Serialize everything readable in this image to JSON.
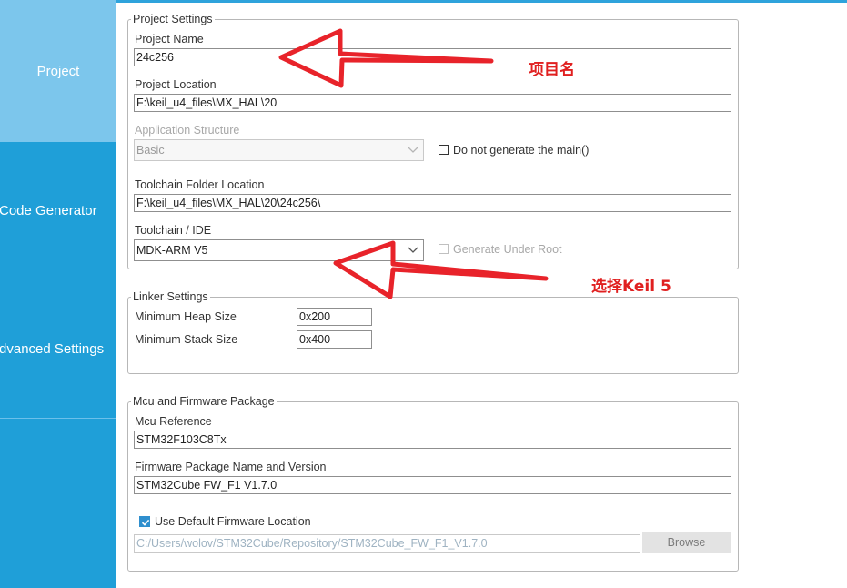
{
  "sidebar": {
    "items": [
      {
        "label": "Project",
        "active": true
      },
      {
        "label": "Code Generator",
        "active": false
      },
      {
        "label": "Advanced Settings",
        "active": false
      }
    ]
  },
  "project_settings": {
    "legend": "Project Settings",
    "project_name_label": "Project Name",
    "project_name_value": "24c256",
    "project_location_label": "Project Location",
    "project_location_value": "F:\\keil_u4_files\\MX_HAL\\20",
    "app_structure_label": "Application Structure",
    "app_structure_value": "Basic",
    "no_main_label": "Do not generate the main()",
    "toolchain_folder_label": "Toolchain Folder Location",
    "toolchain_folder_value": "F:\\keil_u4_files\\MX_HAL\\20\\24c256\\",
    "toolchain_ide_label": "Toolchain / IDE",
    "toolchain_ide_value": "MDK-ARM V5",
    "generate_under_root_label": "Generate Under Root"
  },
  "linker_settings": {
    "legend": "Linker Settings",
    "heap_label": "Minimum Heap Size",
    "heap_value": "0x200",
    "stack_label": "Minimum Stack Size",
    "stack_value": "0x400"
  },
  "mcu_firmware": {
    "legend": "Mcu and Firmware Package",
    "mcu_ref_label": "Mcu Reference",
    "mcu_ref_value": "STM32F103C8Tx",
    "fw_pkg_label": "Firmware Package Name and Version",
    "fw_pkg_value": "STM32Cube FW_F1 V1.7.0",
    "use_default_label": "Use Default Firmware Location",
    "use_default_checked": true,
    "fw_location_value": "C:/Users/wolov/STM32Cube/Repository/STM32Cube_FW_F1_V1.7.0",
    "browse_label": "Browse"
  },
  "annotations": {
    "project_name_note": "项目名",
    "toolchain_note": "选择Keil 5"
  },
  "colors": {
    "sidebar": "#1f9fd8",
    "sidebar_active": "#7cc6ec",
    "annotation": "#e02020",
    "checkbox": "#2f8fce"
  }
}
